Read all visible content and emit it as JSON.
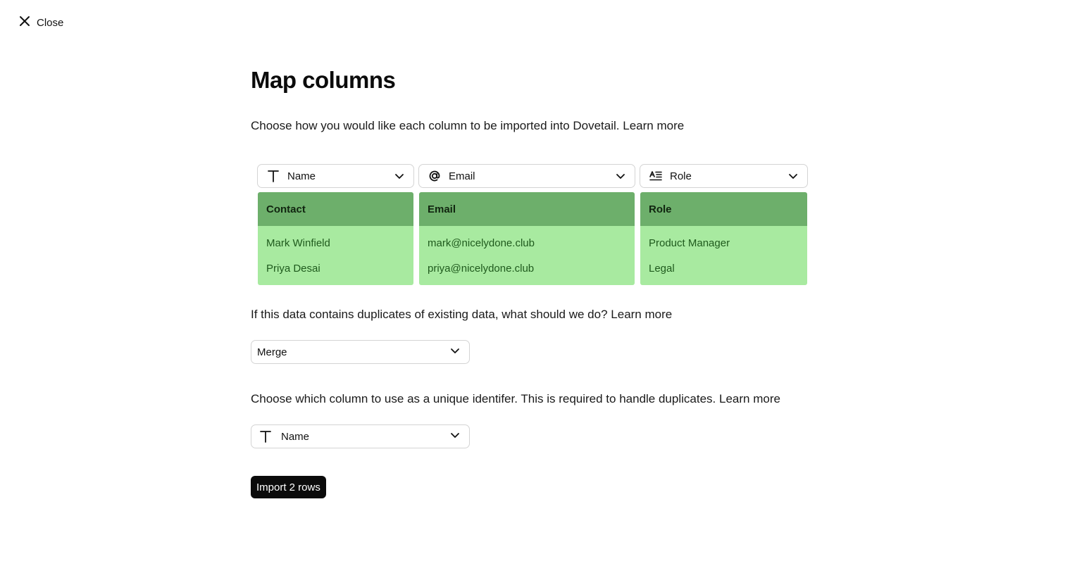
{
  "header": {
    "close_label": "Close"
  },
  "page": {
    "title": "Map columns",
    "intro_text": "Choose how you would like each column to be imported into Dovetail.",
    "intro_link": "Learn more"
  },
  "columns": [
    {
      "field_label": "Name",
      "field_icon": "text-type-icon",
      "header": "Contact",
      "rows": [
        "Mark Winfield",
        "Priya Desai"
      ]
    },
    {
      "field_label": "Email",
      "field_icon": "at-sign-icon",
      "header": "Email",
      "rows": [
        "mark@nicelydone.club",
        "priya@nicelydone.club"
      ]
    },
    {
      "field_label": "Role",
      "field_icon": "text-list-icon",
      "header": "Role",
      "rows": [
        "Product Manager",
        "Legal"
      ]
    }
  ],
  "duplicates": {
    "question": "If this data contains duplicates of existing data, what should we do?",
    "link": "Learn more",
    "selected": "Merge"
  },
  "identifier": {
    "question": "Choose which column to use as a unique identifer. This is required to handle duplicates.",
    "link": "Learn more",
    "selected": "Name",
    "icon": "text-type-icon"
  },
  "actions": {
    "import_label": "Import 2 rows"
  },
  "colors": {
    "header_green": "#6daf6b",
    "row_green": "#a8eaa0",
    "primary_button": "#0b0b0b"
  }
}
